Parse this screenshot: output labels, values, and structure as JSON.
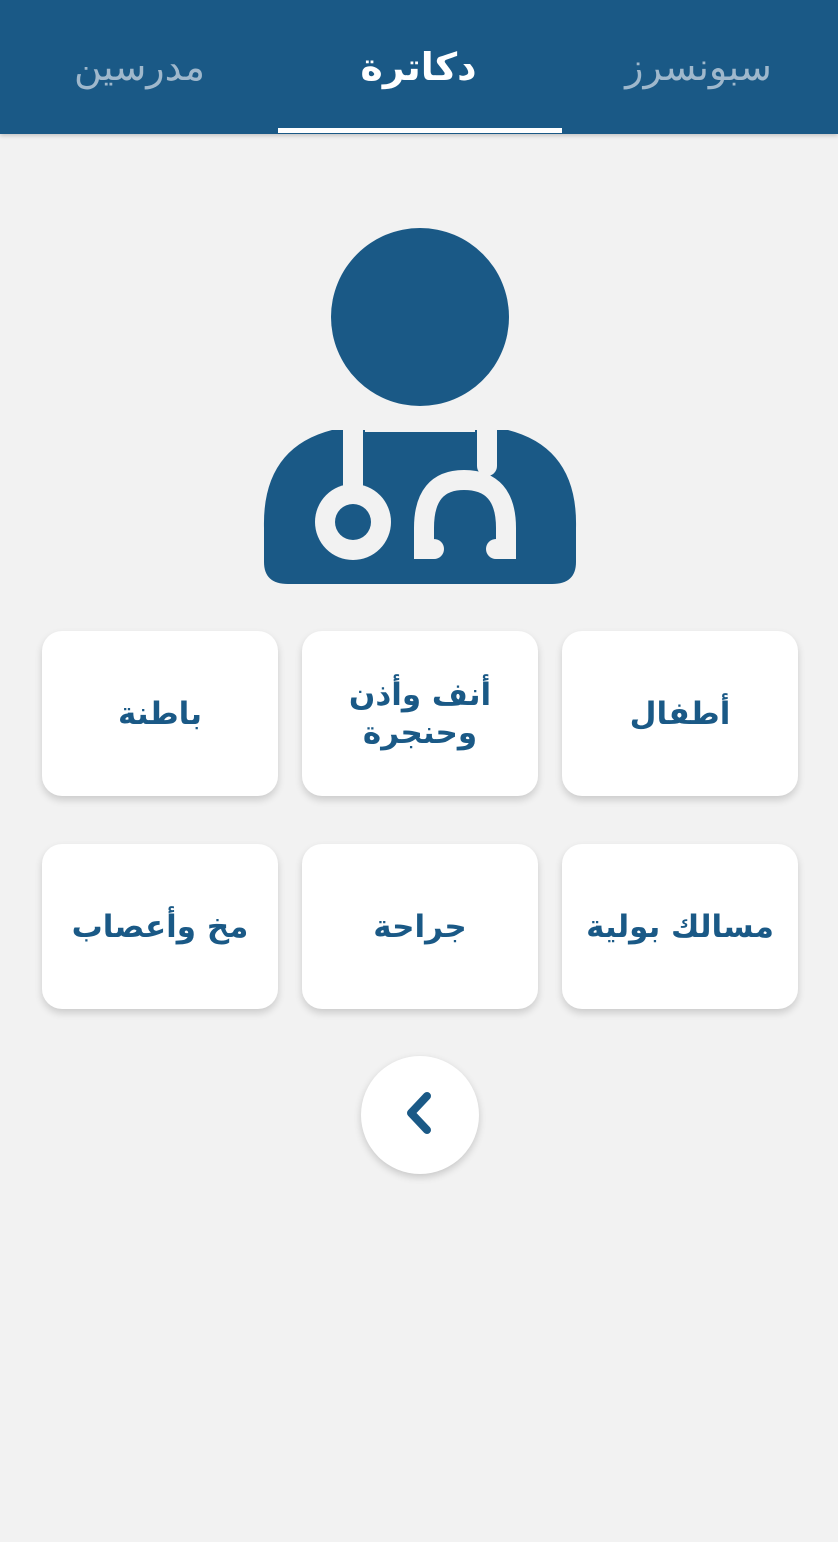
{
  "tabs": {
    "right_label": "سبونسرز",
    "middle_label": "دكاترة",
    "left_label": "مدرسين",
    "active": "middle"
  },
  "hero": {
    "icon": "doctor-stethoscope-icon"
  },
  "specialties": [
    {
      "label": "أطفال"
    },
    {
      "label": "أنف وأذن وحنجرة"
    },
    {
      "label": "باطنة"
    },
    {
      "label": "مسالك بولية"
    },
    {
      "label": "جراحة"
    },
    {
      "label": "مخ وأعصاب"
    }
  ],
  "back_button": {
    "icon": "chevron-left-icon"
  },
  "colors": {
    "primary": "#1a5986",
    "background": "#f2f2f2",
    "card": "#ffffff",
    "inactive_tab": "#9fb8cc"
  }
}
